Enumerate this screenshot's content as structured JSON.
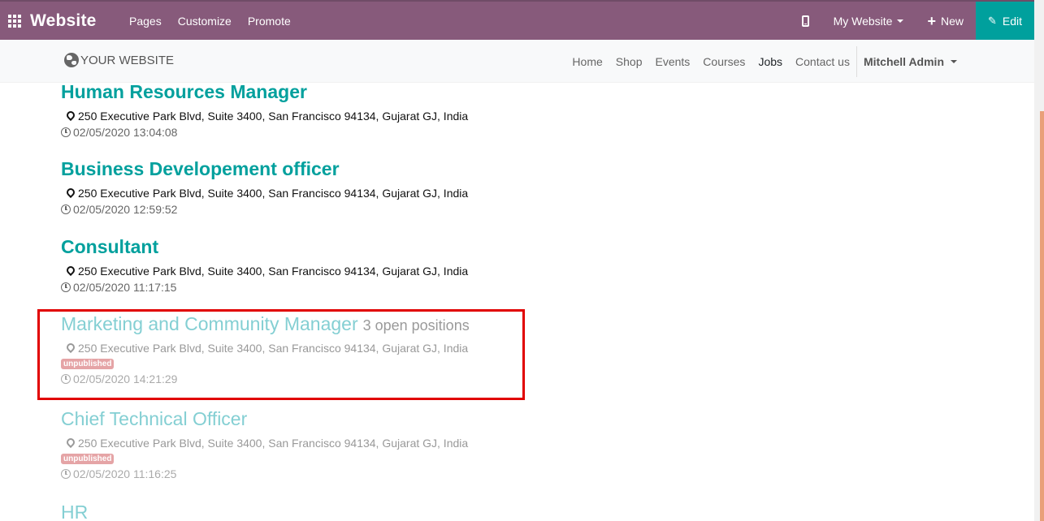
{
  "topbar": {
    "brand": "Website",
    "menu": [
      "Pages",
      "Customize",
      "Promote"
    ],
    "site_selector": "My Website",
    "new_label": "New",
    "edit_label": "Edit",
    "color": "#875a7b",
    "edit_color": "#00a09d"
  },
  "header": {
    "logo": "YOUR WEBSITE",
    "nav": [
      "Home",
      "Shop",
      "Events",
      "Courses",
      "Jobs",
      "Contact us"
    ],
    "active": "Jobs",
    "user": "Mitchell Admin"
  },
  "jobs": [
    {
      "title": "Human Resources Manager",
      "address": "250 Executive Park Blvd, Suite 3400, San Francisco 94134, Gujarat GJ, India",
      "date": "02/05/2020 13:04:08"
    },
    {
      "title": "Business Developement officer",
      "address": "250 Executive Park Blvd, Suite 3400, San Francisco 94134, Gujarat GJ, India",
      "date": "02/05/2020 12:59:52"
    },
    {
      "title": "Consultant",
      "address": "250 Executive Park Blvd, Suite 3400, San Francisco 94134, Gujarat GJ, India",
      "date": "02/05/2020 11:17:15"
    },
    {
      "title": "Marketing and Community Manager",
      "open_positions": "3 open positions",
      "address": "250 Executive Park Blvd, Suite 3400, San Francisco 94134, Gujarat GJ, India",
      "badge": "unpublished",
      "date": "02/05/2020 14:21:29"
    },
    {
      "title": "Chief Technical Officer",
      "address": "250 Executive Park Blvd, Suite 3400, San Francisco 94134, Gujarat GJ, India",
      "badge": "unpublished",
      "date": "02/05/2020 11:16:25"
    },
    {
      "title": "HR"
    }
  ]
}
